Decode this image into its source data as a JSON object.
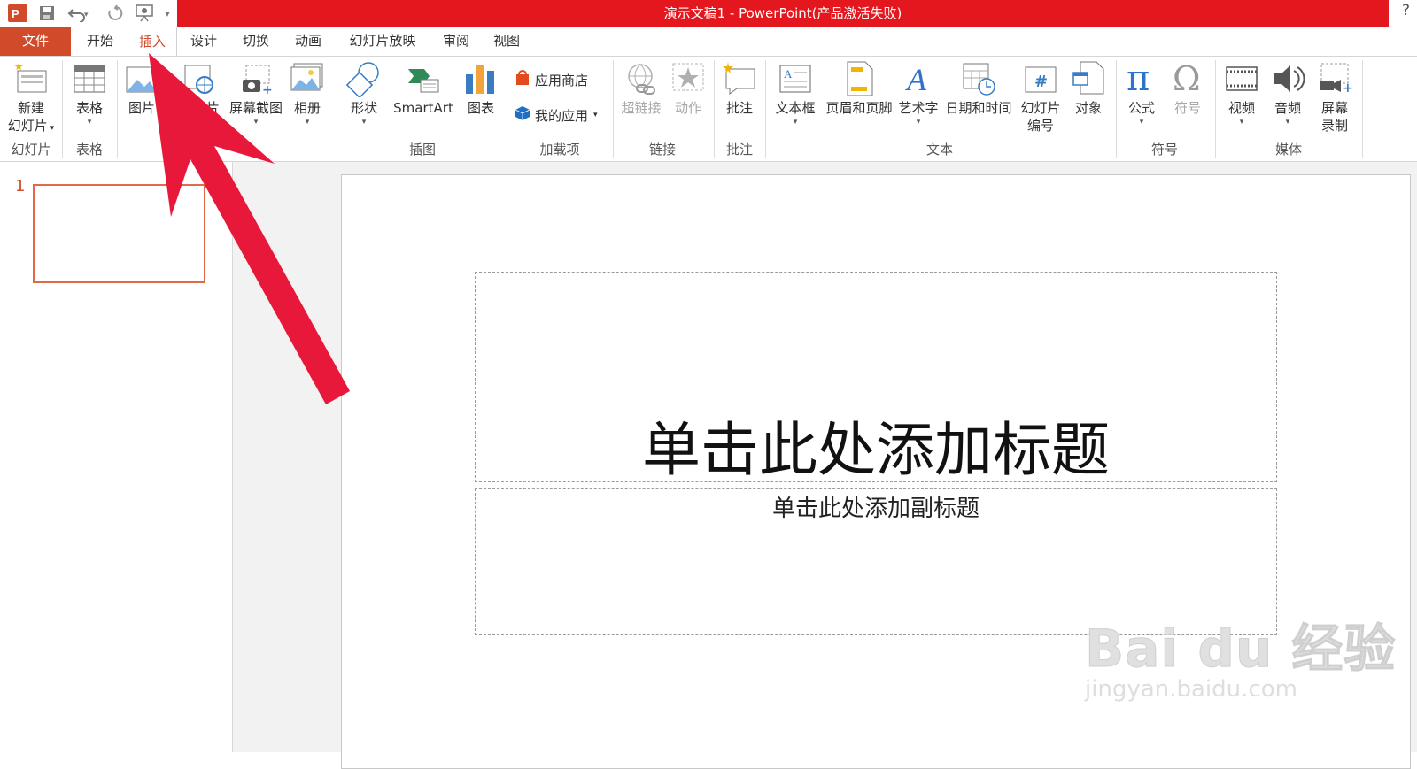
{
  "window": {
    "title": "演示文稿1 - PowerPoint(产品激活失败)",
    "help": "?"
  },
  "qat": {
    "app_icon": "powerpoint-app-icon",
    "save": "save-icon",
    "undo": "undo-icon",
    "redo": "redo-icon",
    "present": "start-slideshow-icon",
    "customize": "▾"
  },
  "tabs": [
    "文件",
    "开始",
    "插入",
    "设计",
    "切换",
    "动画",
    "幻灯片放映",
    "审阅",
    "视图"
  ],
  "ribbon": {
    "slides": {
      "new_slide": "新建",
      "new_slide2": "幻灯片",
      "group": "幻灯片"
    },
    "tables": {
      "table": "表格",
      "group": "表格"
    },
    "images": {
      "picture": "图片",
      "online_pictures_partial": "片",
      "screenshot": "屏幕截图",
      "album": "相册"
    },
    "illustrations": {
      "shapes": "形状",
      "smartart": "SmartArt",
      "chart": "图表",
      "group": "插图"
    },
    "addins": {
      "store": "应用商店",
      "myapps": "我的应用",
      "group": "加载项"
    },
    "links": {
      "hyperlink": "超链接",
      "action": "动作",
      "group": "链接"
    },
    "comments": {
      "comment": "批注",
      "group": "批注"
    },
    "text": {
      "textbox": "文本框",
      "header_footer": "页眉和页脚",
      "wordart": "艺术字",
      "datetime": "日期和时间",
      "slide_number": "幻灯片",
      "slide_number2": "编号",
      "object": "对象",
      "group": "文本"
    },
    "symbols": {
      "equation": "公式",
      "symbol": "符号",
      "group": "符号"
    },
    "media": {
      "video": "视频",
      "audio": "音频",
      "screen_recording": "屏幕",
      "screen_recording2": "录制",
      "group": "媒体"
    }
  },
  "thumbnails": {
    "slide_number": "1"
  },
  "slide": {
    "title_placeholder": "单击此处添加标题",
    "subtitle_placeholder": "单击此处添加副标题"
  },
  "watermark": {
    "brand": "Bai du 经验",
    "url": "jingyan.baidu.com"
  },
  "colors": {
    "title_bar": "#e3171d",
    "file_tab": "#d14a2a",
    "accent": "#d14a2a",
    "arrow": "#e8183a"
  }
}
